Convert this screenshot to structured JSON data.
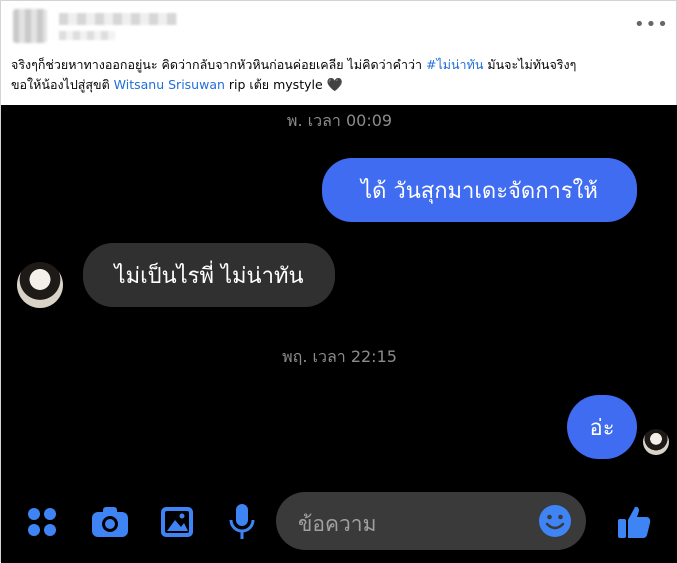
{
  "post": {
    "caption_lead": "จริงๆก็ช่วยหาทางออกอยู่นะ คิดว่ากลับจากหัวหินก่อนค่อยเคลีย ไม่คิดว่าคำว่า",
    "hashtag": "#ไม่น่าทัน",
    "caption_after_hashtag": " มันจะไม่ทันจริงๆ",
    "line2_lead": "ขอให้น้องไปสู่สุขติ ",
    "mention": "Witsanu Srisuwan",
    "line2_tail": "   rip เต้ย mystyle ",
    "heart_glyph": "🖤",
    "more_glyph": "•••",
    "link_color": "#216fdb"
  },
  "chat": {
    "time_1": "พ. เวลา 00:09",
    "msg_out_1": "ได้ วันสุกมาเดะจัดการให้",
    "msg_in_1": "ไม่เป็นไรพี่ ไม่น่าทัน",
    "time_2": "พฤ. เวลา 22:15",
    "msg_out_2": "อ่ะ",
    "composer_placeholder": "ข้อความ",
    "accent_color": "#3f6cf0"
  },
  "icons": {
    "menu": "grid-dots-icon",
    "camera": "camera-icon",
    "gallery": "image-icon",
    "mic": "microphone-icon",
    "emoji": "emoji-icon",
    "like": "thumbs-up-icon"
  }
}
